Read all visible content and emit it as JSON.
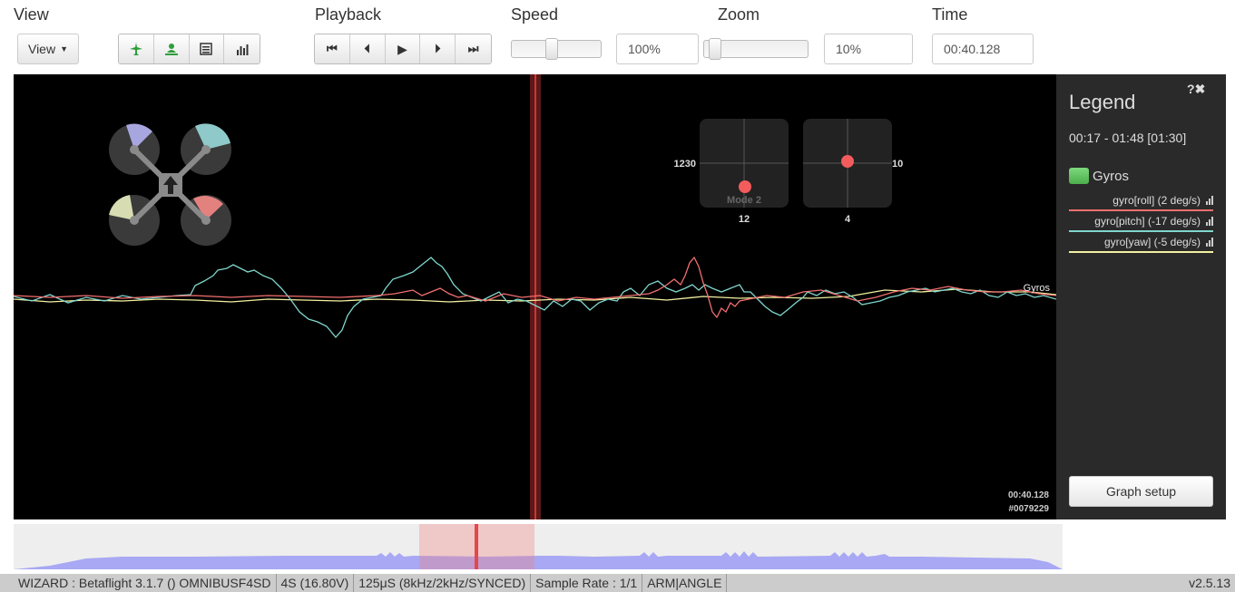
{
  "header": {
    "view_label": "View",
    "playback_label": "Playback",
    "speed_label": "Speed",
    "zoom_label": "Zoom",
    "time_label": "Time"
  },
  "toolbar": {
    "view_dropdown": "View",
    "speed_value": "100%",
    "zoom_value": "10%",
    "time_value": "00:40.128",
    "speed_slider_level": 0.44,
    "zoom_slider_level": 0.05
  },
  "graph": {
    "series_label": "Gyros",
    "cursor_time": "00:40.128",
    "cursor_frame": "#0079229",
    "stick_left": {
      "left_value": "1230",
      "bottom_value": "12",
      "mode": "Mode 2"
    },
    "stick_right": {
      "right_value": "10",
      "bottom_value": "4"
    }
  },
  "legend": {
    "title": "Legend",
    "range": "00:17 - 01:48 [01:30]",
    "group_name": "Gyros",
    "group_color": "#4cae4c",
    "items": [
      {
        "label": "gyro[roll] (2 deg/s)",
        "color": "#f36f6f"
      },
      {
        "label": "gyro[pitch] (-17 deg/s)",
        "color": "#7fd6cd"
      },
      {
        "label": "gyro[yaw] (-5 deg/s)",
        "color": "#f2f1a0"
      }
    ],
    "graph_setup_button": "Graph setup"
  },
  "status_bar": {
    "segments": [
      "WIZARD : Betaflight 3.1.7 () OMNIBUSF4SD",
      "4S (16.80V)",
      "125μS (8kHz/2kHz/SYNCED)",
      "Sample Rate : 1/1",
      "ARM|ANGLE"
    ],
    "version": "v2.5.13"
  },
  "colors": {
    "accent_green": "#2e9e3b",
    "motor_fl": "#a8a6df",
    "motor_fr": "#8fc9c9",
    "motor_rl": "#d7dcb2",
    "motor_rr": "#e3817f"
  }
}
